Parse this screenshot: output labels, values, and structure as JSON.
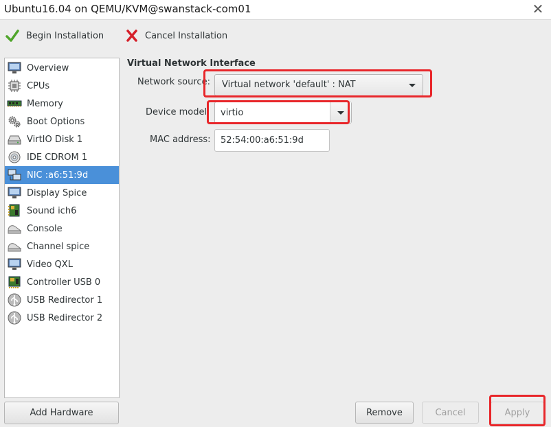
{
  "window": {
    "title": "Ubuntu16.04 on QEMU/KVM@swanstack-com01",
    "close_icon": "close-icon"
  },
  "toolbar": {
    "begin_label": "Begin Installation",
    "cancel_label": "Cancel Installation",
    "colors": {
      "check": "#4fa52a",
      "cross": "#d6202a"
    }
  },
  "sidebar": {
    "selected_index": 6,
    "items": [
      {
        "label": "Overview",
        "icon": "monitor-icon"
      },
      {
        "label": "CPUs",
        "icon": "cpu-icon"
      },
      {
        "label": "Memory",
        "icon": "memory-icon"
      },
      {
        "label": "Boot Options",
        "icon": "gears-icon"
      },
      {
        "label": "VirtIO Disk 1",
        "icon": "disk-icon"
      },
      {
        "label": "IDE CDROM 1",
        "icon": "cdrom-icon"
      },
      {
        "label": "NIC :a6:51:9d",
        "icon": "network-icon"
      },
      {
        "label": "Display Spice",
        "icon": "display-icon"
      },
      {
        "label": "Sound ich6",
        "icon": "sound-card-icon"
      },
      {
        "label": "Console",
        "icon": "console-icon"
      },
      {
        "label": "Channel spice",
        "icon": "channel-icon"
      },
      {
        "label": "Video QXL",
        "icon": "video-icon"
      },
      {
        "label": "Controller USB 0",
        "icon": "controller-icon"
      },
      {
        "label": "USB Redirector 1",
        "icon": "usb-icon"
      },
      {
        "label": "USB Redirector 2",
        "icon": "usb-icon"
      }
    ],
    "add_hardware_label": "Add Hardware"
  },
  "details": {
    "section_title": "Virtual Network Interface",
    "network_source_label": "Network source:",
    "network_source_value": "Virtual network 'default' : NAT",
    "device_model_label": "Device model:",
    "device_model_value": "virtio",
    "mac_label": "MAC address:",
    "mac_value": "52:54:00:a6:51:9d"
  },
  "buttons": {
    "remove": "Remove",
    "cancel": "Cancel",
    "apply": "Apply"
  },
  "highlight_color": "#e8262a"
}
